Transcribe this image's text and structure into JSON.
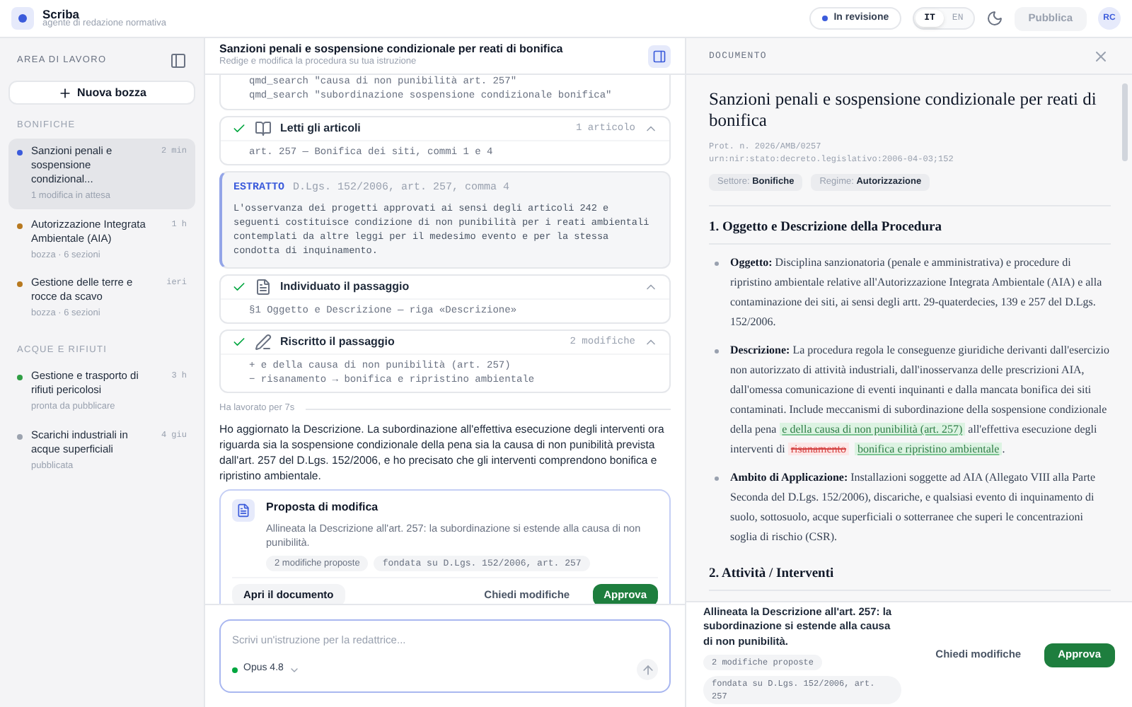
{
  "app": {
    "name": "Scriba",
    "subtitle": "agente di redazione normativa"
  },
  "topbar": {
    "status": "In revisione",
    "languages": [
      {
        "label": "IT",
        "selected": true
      },
      {
        "label": "EN",
        "selected": false
      }
    ],
    "publish": "Pubblica",
    "avatar": "RC"
  },
  "sidebar": {
    "title": "AREA DI LAVORO",
    "new_button": "Nuova bozza",
    "groups": [
      {
        "title": "BONIFICHE",
        "items": [
          {
            "title": "Sanzioni penali e sospensione condizional...",
            "time": "2 min",
            "meta": "1 modifica in attesa",
            "color": "#3b5bdb",
            "selected": true
          },
          {
            "title": "Autorizzazione Integrata Ambientale (AIA)",
            "time": "1 h",
            "meta": "bozza · 6 sezioni",
            "color": "#b7791f",
            "selected": false
          },
          {
            "title": "Gestione delle terre e rocce da scavo",
            "time": "ieri",
            "meta": "bozza · 6 sezioni",
            "color": "#b7791f",
            "selected": false
          }
        ]
      },
      {
        "title": "ACQUE E RIFIUTI",
        "items": [
          {
            "title": "Gestione e trasporto di rifiuti pericolosi",
            "time": "3 h",
            "meta": "pronta da pubblicare",
            "color": "#2f9e44",
            "selected": false
          },
          {
            "title": "Scarichi industriali in acque superficiali",
            "time": "4 giu",
            "meta": "pubblicata",
            "color": "#9ca3af",
            "selected": false
          }
        ]
      }
    ]
  },
  "chat": {
    "title": "Sanzioni penali e sospensione condizionale per reati di bonifica",
    "subtitle": "Redige e modifica la procedura su tua istruzione",
    "steps": [
      {
        "kind": "search",
        "lines": [
          "qmd_search \"causa di non punibilità art. 257\"",
          "qmd_search \"subordinazione sospensione condizionale bonifica\""
        ]
      },
      {
        "kind": "read",
        "title": "Letti gli articoli",
        "count": "1 articolo",
        "lines": [
          "art. 257 — Bonifica dei siti, commi 1 e 4"
        ]
      },
      {
        "kind": "excerpt",
        "label": "ESTRATTO",
        "source": "D.Lgs. 152/2006, art. 257, comma 4",
        "text": "L'osservanza dei progetti approvati ai sensi degli articoli 242 e seguenti costituisce condizione di non punibilità per i reati ambientali contemplati da altre leggi per il medesimo evento e per la stessa condotta di inquinamento."
      },
      {
        "kind": "locate",
        "title": "Individuato il passaggio",
        "lines": [
          "§1 Oggetto e Descrizione — riga «Descrizione»"
        ]
      },
      {
        "kind": "rewrite",
        "title": "Riscritto il passaggio",
        "count": "2 modifiche",
        "lines": [
          "+ e della causa di non punibilità (art. 257)",
          "− risanamento → bonifica e ripristino ambientale"
        ]
      }
    ],
    "worked": "Ha lavorato per 7s",
    "message": "Ho aggiornato la Descrizione. La subordinazione all'effettiva esecuzione degli interventi ora riguarda sia la sospensione condizionale della pena sia la causa di non punibilità prevista dall'art. 257 del D.Lgs. 152/2006, e ho precisato che gli interventi comprendono bonifica e ripristino ambientale.",
    "proposal": {
      "title": "Proposta di modifica",
      "text": "Allineata la Descrizione all'art. 257: la subordinazione si estende alla causa di non punibilità.",
      "tags": [
        "2 modifiche proposte",
        "fondata su D.Lgs. 152/2006, art. 257"
      ],
      "open": "Apri il documento",
      "ask": "Chiedi modifiche",
      "approve": "Approva"
    },
    "input": {
      "placeholder": "Scrivi un'istruzione per la redattrice...",
      "model": "Opus 4.8"
    }
  },
  "document": {
    "header": "DOCUMENTO",
    "title": "Sanzioni penali e sospensione condizionale per reati di bonifica",
    "meta": [
      "Prot. n. 2026/AMB/0257",
      "urn:nir:stato:decreto.legislativo:2006-04-03;152"
    ],
    "tags": [
      {
        "label": "Settore:",
        "value": "Bonifiche"
      },
      {
        "label": "Regime:",
        "value": "Autorizzazione"
      }
    ],
    "sections": [
      {
        "title": "1. Oggetto e Descrizione della Procedura",
        "items": [
          {
            "label": "Oggetto:",
            "parts": [
              {
                "kind": "text",
                "text": "Disciplina sanzionatoria (penale e amministrativa) e procedure di ripristino ambientale relative all'Autorizzazione Integrata Ambientale (AIA) e alla contaminazione dei siti, ai sensi degli artt. 29-quaterdecies, 139 e 257 del D.Lgs. 152/2006."
              }
            ]
          },
          {
            "label": "Descrizione:",
            "parts": [
              {
                "kind": "text",
                "text": "La procedura regola le conseguenze giuridiche derivanti dall'esercizio non autorizzato di attività industriali, dall'inosservanza delle prescrizioni AIA, dall'omessa comunicazione di eventi inquinanti e dalla mancata bonifica dei siti contaminati. Include meccanismi di subordinazione della sospensione condizionale della pena "
              },
              {
                "kind": "insert",
                "text": "e della causa di non punibilità (art. 257)"
              },
              {
                "kind": "text",
                "text": " all'effettiva esecuzione degli interventi di "
              },
              {
                "kind": "delete",
                "text": "risanamento"
              },
              {
                "kind": "insert",
                "text": "bonifica e ripristino ambientale"
              },
              {
                "kind": "text",
                "text": "."
              }
            ]
          },
          {
            "label": "Ambito di Applicazione:",
            "parts": [
              {
                "kind": "text",
                "text": "Installazioni soggette ad AIA (Allegato VIII alla Parte Seconda del D.Lgs. 152/2006), discariche, e qualsiasi evento di inquinamento di suolo, sottosuolo, acque superficiali o sotterranee che superi le concentrazioni soglia di rischio (CSR)."
              }
            ]
          }
        ]
      },
      {
        "title": "2. Attività / Interventi"
      }
    ],
    "footer": {
      "text": "Allineata la Descrizione all'art. 257: la subordinazione si estende alla causa di non punibilità.",
      "tags": [
        "2 modifiche proposte",
        "fondata su D.Lgs. 152/2006, art. 257"
      ],
      "ask": "Chiedi modifiche",
      "approve": "Approva"
    }
  }
}
